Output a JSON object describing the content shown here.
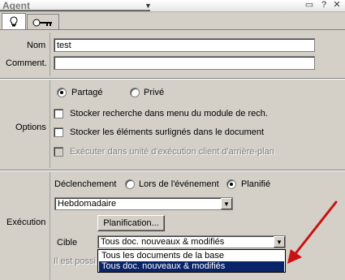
{
  "window": {
    "title": "Agent"
  },
  "tabs": [
    {
      "icon": "bulb-icon"
    },
    {
      "icon": "key-icon"
    }
  ],
  "fields": {
    "nom_label": "Nom",
    "nom_value": "test",
    "comment_label": "Comment.",
    "comment_value": ""
  },
  "options": {
    "section_label": "Options",
    "shared_label": "Partagé",
    "private_label": "Privé",
    "selected": "Partagé",
    "check1_label": "Stocker recherche dans menu du module de rech.",
    "check2_label": "Stocker les éléments surlignés dans le document",
    "check3_label": "Exécuter dans unité d'exécution client d'arrière-plan"
  },
  "execution": {
    "section_label": "Exécution",
    "trigger_label": "Déclenchement",
    "on_event_label": "Lors de l'événement",
    "scheduled_label": "Planifié",
    "selected_trigger": "Planifié",
    "frequency_value": "Hebdomadaire",
    "schedule_button": "Planification...",
    "target_label": "Cible",
    "target_value": "Tous doc. nouveaux & modifiés",
    "target_options": [
      "Tous les documents de la base",
      "Tous doc. nouveaux & modifiés"
    ],
    "hint_partial": "Il est possi"
  },
  "colors": {
    "selection": "#0a246a",
    "annotation_arrow": "#cc1111"
  }
}
